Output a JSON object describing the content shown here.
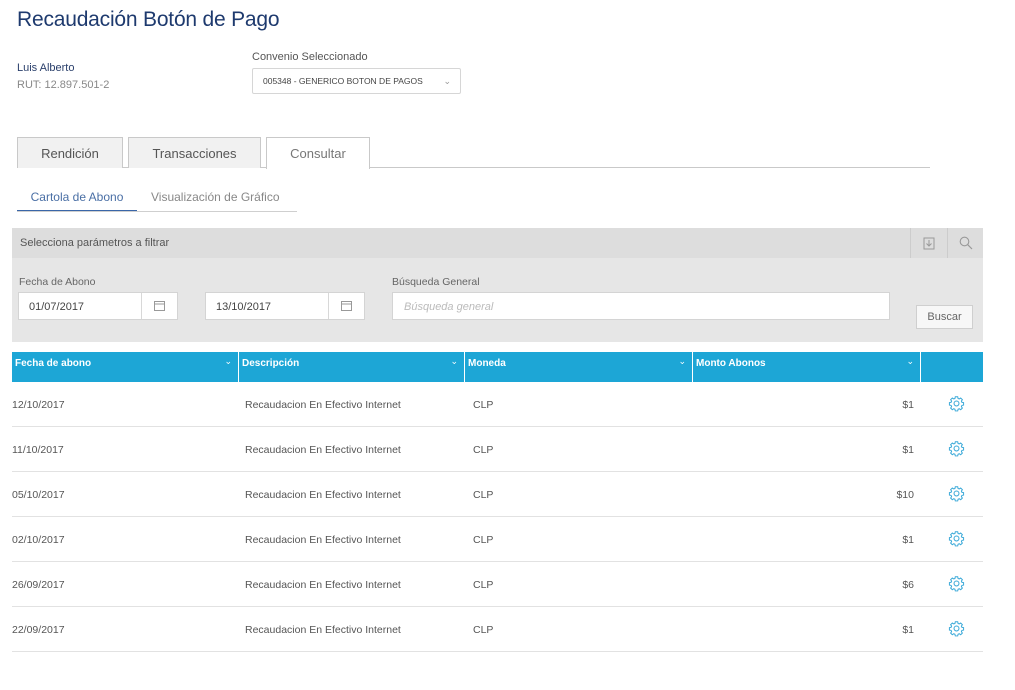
{
  "page": {
    "title": "Recaudación Botón de Pago"
  },
  "user": {
    "name": "Luis Alberto",
    "rut": "RUT: 12.897.501-2"
  },
  "convenio": {
    "label": "Convenio Seleccionado",
    "value": "005348 - GENERICO BOTON DE PAGOS",
    "chevron_icon": "chevron-down-icon"
  },
  "tabs": [
    {
      "label": "Rendición",
      "active": false
    },
    {
      "label": "Transacciones",
      "active": false
    },
    {
      "label": "Consultar",
      "active": true
    }
  ],
  "subtabs": [
    {
      "label": "Cartola de Abono",
      "active": true
    },
    {
      "label": "Visualización de Gráfico",
      "active": false
    }
  ],
  "filter": {
    "header": "Selecciona parámetros a filtrar",
    "download_icon": "download-icon",
    "search_icon": "search-icon",
    "date_label": "Fecha de Abono",
    "date_from": "01/07/2017",
    "date_to": "13/10/2017",
    "general_label": "Búsqueda General",
    "general_placeholder": "Búsqueda general",
    "button": "Buscar"
  },
  "table": {
    "header_color": "#1da6d6",
    "columns": [
      "Fecha de abono",
      "Descripción",
      "Moneda",
      "Monto Abonos"
    ],
    "rows": [
      {
        "fecha": "12/10/2017",
        "descripcion": "Recaudacion En Efectivo Internet",
        "moneda": "CLP",
        "monto": "$1"
      },
      {
        "fecha": "11/10/2017",
        "descripcion": "Recaudacion En Efectivo Internet",
        "moneda": "CLP",
        "monto": "$1"
      },
      {
        "fecha": "05/10/2017",
        "descripcion": "Recaudacion En Efectivo Internet",
        "moneda": "CLP",
        "monto": "$10"
      },
      {
        "fecha": "02/10/2017",
        "descripcion": "Recaudacion En Efectivo Internet",
        "moneda": "CLP",
        "monto": "$1"
      },
      {
        "fecha": "26/09/2017",
        "descripcion": "Recaudacion En Efectivo Internet",
        "moneda": "CLP",
        "monto": "$6"
      },
      {
        "fecha": "22/09/2017",
        "descripcion": "Recaudacion En Efectivo Internet",
        "moneda": "CLP",
        "monto": "$1"
      }
    ],
    "row_action_icon": "gear-icon"
  }
}
